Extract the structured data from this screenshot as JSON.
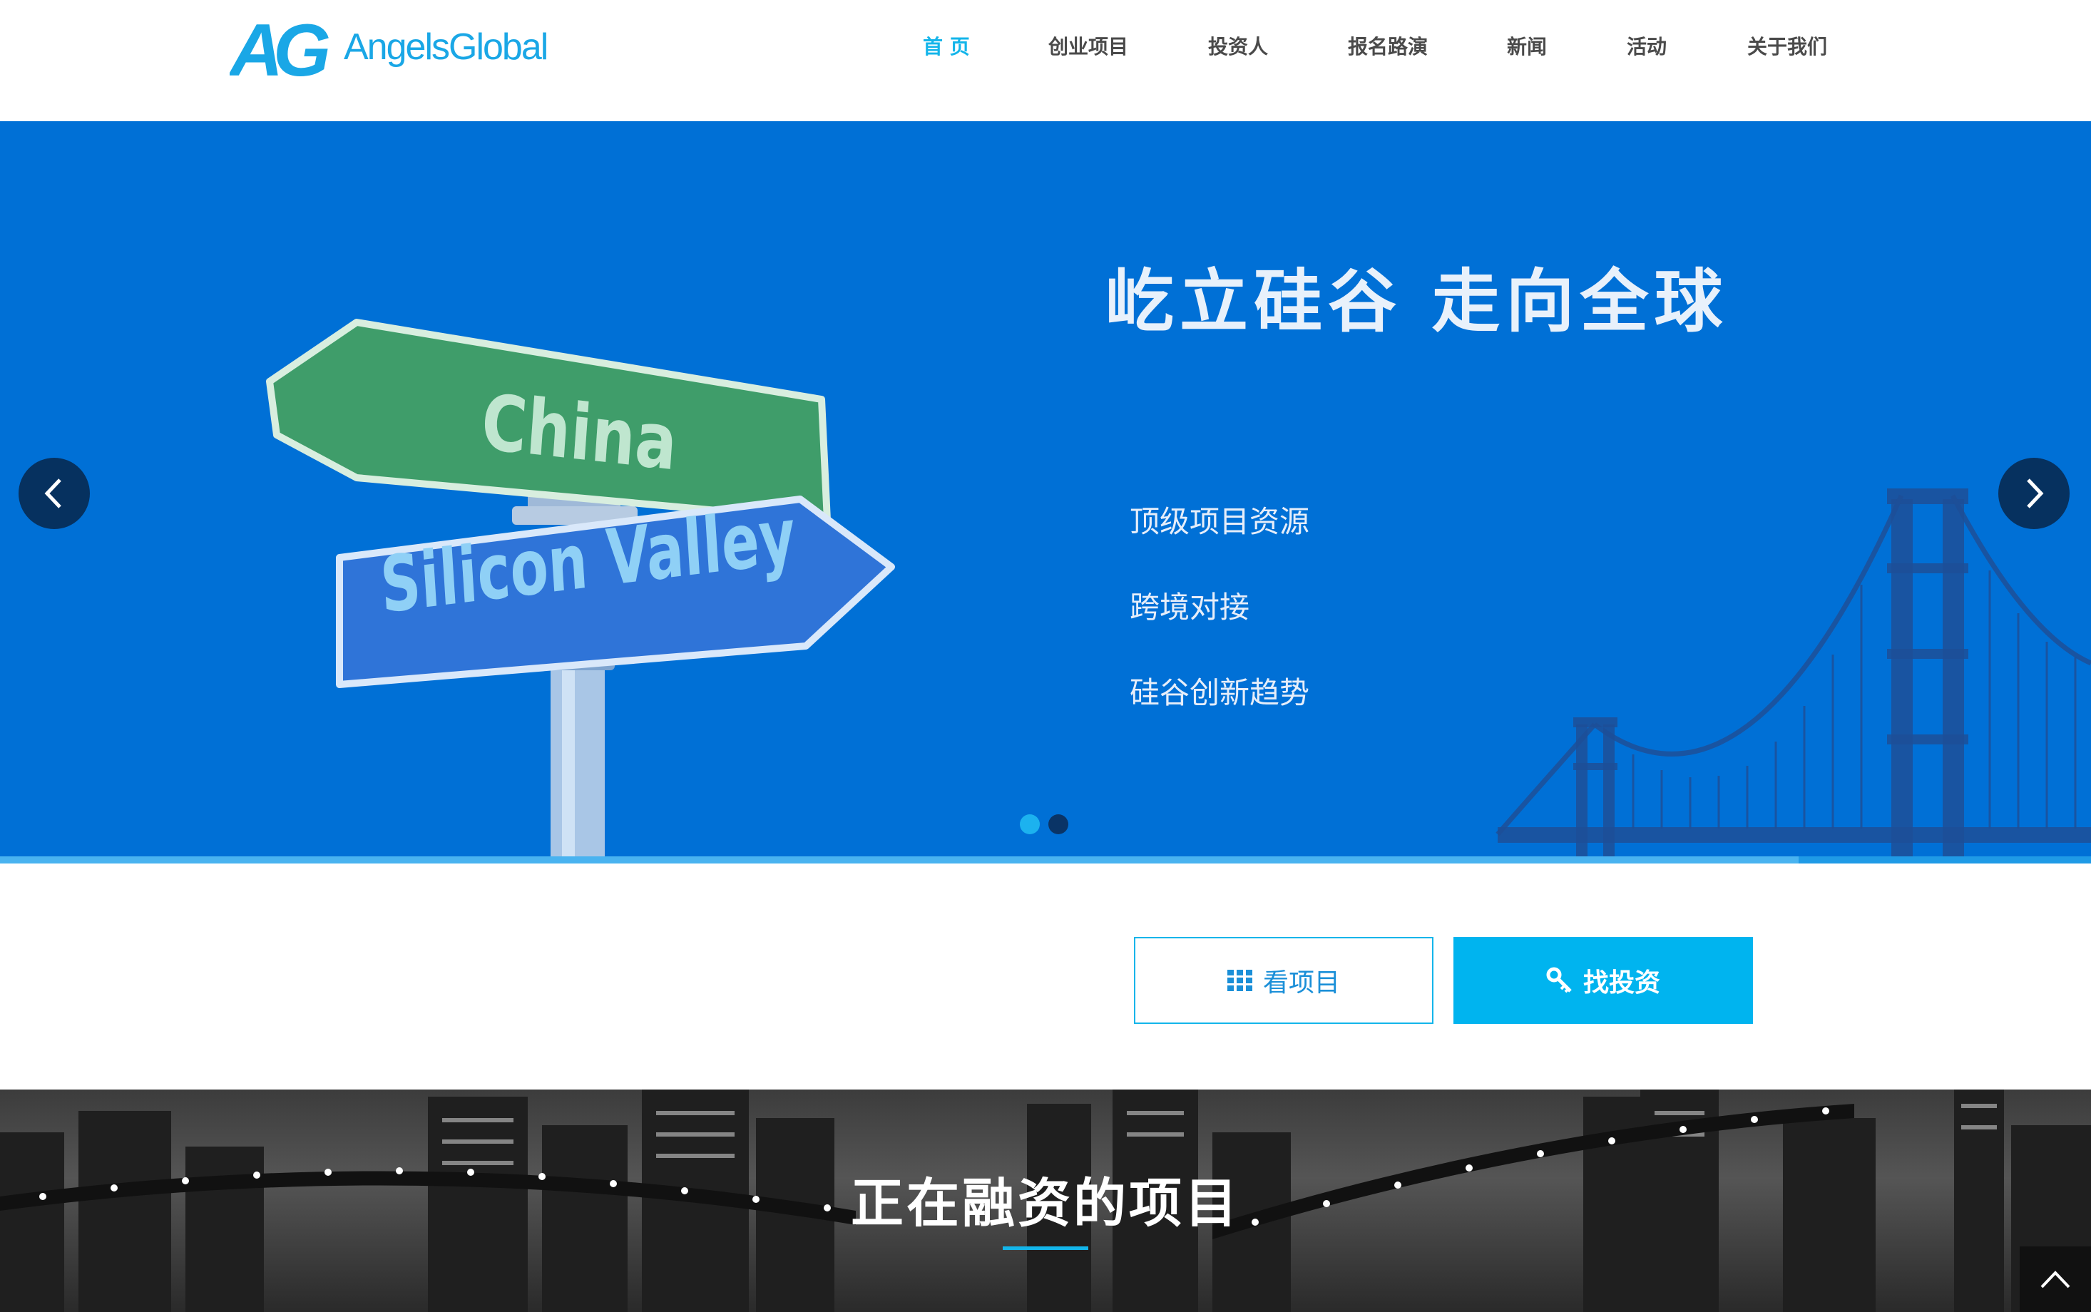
{
  "brand": {
    "mark": "AG",
    "name": "AngelsGlobal",
    "color": "#1aa7e6"
  },
  "nav": {
    "items": [
      {
        "label": "首 页",
        "active": true
      },
      {
        "label": "创业项目",
        "active": false
      },
      {
        "label": "投资人",
        "active": false
      },
      {
        "label": "报名路演",
        "active": false
      },
      {
        "label": "新闻",
        "active": false
      },
      {
        "label": "活动",
        "active": false
      },
      {
        "label": "关于我们",
        "active": false
      }
    ],
    "active_color": "#13b5ea"
  },
  "hero": {
    "title": "屹立硅谷 走向全球",
    "features": [
      "顶级项目资源",
      "跨境对接",
      "硅谷创新趋势"
    ],
    "sign_top": "China",
    "sign_bottom": "Silicon Valley",
    "background": "#0070d6",
    "slides": {
      "count": 2,
      "active_index": 0
    },
    "progress": 0.86,
    "prev_icon": "chevron-left-icon",
    "next_icon": "chevron-right-icon"
  },
  "actions": {
    "view_projects": {
      "label": "看项目",
      "icon": "grid-icon"
    },
    "find_investment": {
      "label": "找投资",
      "icon": "key-icon"
    }
  },
  "section": {
    "title": "正在融资的项目",
    "accent": "#13b5ea"
  },
  "back_to_top": {
    "icon": "chevron-up-icon"
  }
}
